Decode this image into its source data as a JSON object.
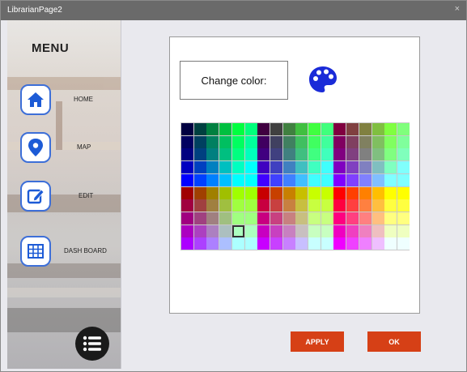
{
  "window": {
    "title": "LibrarianPage2",
    "close_glyph": "×"
  },
  "sidebar": {
    "menu_title": "MENU",
    "items": [
      {
        "label": "HOME",
        "icon": "home-icon"
      },
      {
        "label": "MAP",
        "icon": "map-pin-icon"
      },
      {
        "label": "EDIT",
        "icon": "edit-icon"
      },
      {
        "label": "DASH BOARD",
        "icon": "grid-table-icon"
      }
    ],
    "fab_icon": "list-menu-icon"
  },
  "panel": {
    "change_color_label": "Change color:",
    "palette_icon": "palette-icon",
    "accent_color": "#1a2bd8",
    "palette": {
      "rows": 10,
      "cols": 18,
      "selected": {
        "row": 8,
        "col": 4
      }
    }
  },
  "buttons": {
    "apply_label": "APPLY",
    "ok_label": "OK",
    "color": "#d64016"
  }
}
